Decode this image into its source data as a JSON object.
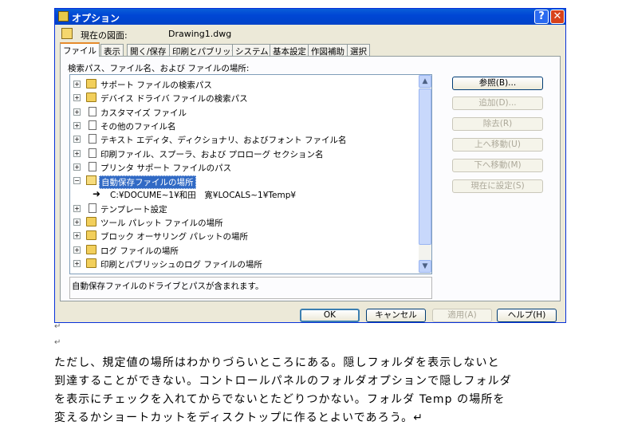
{
  "dialog": {
    "title": "オプション",
    "help_symbol": "?",
    "close_symbol": "✕",
    "drawing_label": "現在の図面:",
    "drawing_value": "Drawing1.dwg",
    "tabs": [
      "ファイル",
      "表示",
      "開く/保存",
      "印刷とパブリッシュ",
      "システム",
      "基本設定",
      "作図補助",
      "選択"
    ],
    "active_tab": "ファイル",
    "section_label": "検索パス、ファイル名、および ファイルの場所:",
    "tree_items": [
      {
        "label": "サポート ファイルの検索パス",
        "icon": "folder-icon",
        "expander": "+"
      },
      {
        "label": "デバイス ドライバ ファイルの検索パス",
        "icon": "folder-icon",
        "expander": "+"
      },
      {
        "label": "カスタマイズ ファイル",
        "icon": "file-icon",
        "expander": "+"
      },
      {
        "label": "その他のファイル名",
        "icon": "file-icon",
        "expander": "+"
      },
      {
        "label": "テキスト エディタ、ディクショナリ、およびフォント ファイル名",
        "icon": "file-icon",
        "expander": "+"
      },
      {
        "label": "印刷ファイル、スプーラ、および プロローグ セクション名",
        "icon": "file-icon",
        "expander": "+"
      },
      {
        "label": "プリンタ サポート ファイルのパス",
        "icon": "file-icon",
        "expander": "+"
      },
      {
        "label": "自動保存ファイルの場所",
        "icon": "open-folder-icon",
        "expander": "−",
        "selected": true
      },
      {
        "label": "C:¥DOCUME~1¥和田　寛¥LOCALS~1¥Temp¥",
        "icon": "arrow-icon",
        "child": true
      },
      {
        "label": "テンプレート設定",
        "icon": "file-icon",
        "expander": "+"
      },
      {
        "label": "ツール パレット ファイルの場所",
        "icon": "folder-icon",
        "expander": "+"
      },
      {
        "label": "ブロック オーサリング パレットの場所",
        "icon": "folder-icon",
        "expander": "+"
      },
      {
        "label": "ログ ファイルの場所",
        "icon": "folder-icon",
        "expander": "+"
      },
      {
        "label": "印刷とパブリッシュのログ ファイルの場所",
        "icon": "folder-icon",
        "expander": "+"
      }
    ],
    "description": "自動保存ファイルのドライブとパスが含まれます。",
    "side_buttons": [
      {
        "label": "参照(B)...",
        "enabled": true
      },
      {
        "label": "追加(D)...",
        "enabled": false
      },
      {
        "label": "除去(R)",
        "enabled": false
      },
      {
        "label": "上へ移動(U)",
        "enabled": false
      },
      {
        "label": "下へ移動(M)",
        "enabled": false
      },
      {
        "label": "現在に設定(S)",
        "enabled": false
      }
    ],
    "bottom_buttons": {
      "ok": "OK",
      "cancel": "キャンセル",
      "apply": "適用(A)",
      "help": "ヘルプ(H)"
    }
  },
  "pilcrow_marks": [
    "↵",
    "↵",
    "↵"
  ],
  "paragraph_lines": [
    "ただし、規定値の場所はわかりづらいところにある。隠しフォルダを表示しないと",
    "到達することができない。コントロールパネルのフォルダオプションで隠しフォルダ",
    "を表示にチェックを入れてからでないとたどりつかない。フォルダ Temp の場所を",
    "変えるかショートカットをディスクトップに作るとよいであろう。↵"
  ]
}
